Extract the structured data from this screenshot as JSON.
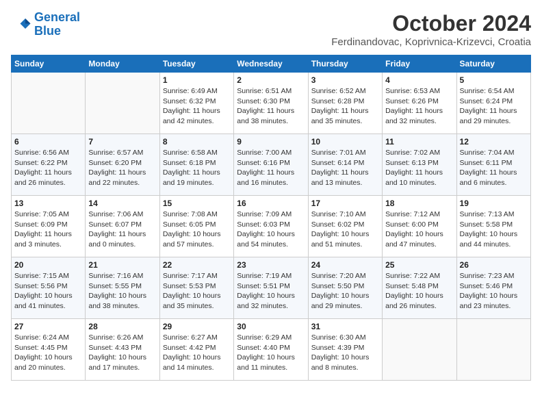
{
  "header": {
    "logo_line1": "General",
    "logo_line2": "Blue",
    "month": "October 2024",
    "location": "Ferdinandovac, Koprivnica-Krizevci, Croatia"
  },
  "weekdays": [
    "Sunday",
    "Monday",
    "Tuesday",
    "Wednesday",
    "Thursday",
    "Friday",
    "Saturday"
  ],
  "weeks": [
    [
      {
        "day": "",
        "info": ""
      },
      {
        "day": "",
        "info": ""
      },
      {
        "day": "1",
        "info": "Sunrise: 6:49 AM\nSunset: 6:32 PM\nDaylight: 11 hours and 42 minutes."
      },
      {
        "day": "2",
        "info": "Sunrise: 6:51 AM\nSunset: 6:30 PM\nDaylight: 11 hours and 38 minutes."
      },
      {
        "day": "3",
        "info": "Sunrise: 6:52 AM\nSunset: 6:28 PM\nDaylight: 11 hours and 35 minutes."
      },
      {
        "day": "4",
        "info": "Sunrise: 6:53 AM\nSunset: 6:26 PM\nDaylight: 11 hours and 32 minutes."
      },
      {
        "day": "5",
        "info": "Sunrise: 6:54 AM\nSunset: 6:24 PM\nDaylight: 11 hours and 29 minutes."
      }
    ],
    [
      {
        "day": "6",
        "info": "Sunrise: 6:56 AM\nSunset: 6:22 PM\nDaylight: 11 hours and 26 minutes."
      },
      {
        "day": "7",
        "info": "Sunrise: 6:57 AM\nSunset: 6:20 PM\nDaylight: 11 hours and 22 minutes."
      },
      {
        "day": "8",
        "info": "Sunrise: 6:58 AM\nSunset: 6:18 PM\nDaylight: 11 hours and 19 minutes."
      },
      {
        "day": "9",
        "info": "Sunrise: 7:00 AM\nSunset: 6:16 PM\nDaylight: 11 hours and 16 minutes."
      },
      {
        "day": "10",
        "info": "Sunrise: 7:01 AM\nSunset: 6:14 PM\nDaylight: 11 hours and 13 minutes."
      },
      {
        "day": "11",
        "info": "Sunrise: 7:02 AM\nSunset: 6:13 PM\nDaylight: 11 hours and 10 minutes."
      },
      {
        "day": "12",
        "info": "Sunrise: 7:04 AM\nSunset: 6:11 PM\nDaylight: 11 hours and 6 minutes."
      }
    ],
    [
      {
        "day": "13",
        "info": "Sunrise: 7:05 AM\nSunset: 6:09 PM\nDaylight: 11 hours and 3 minutes."
      },
      {
        "day": "14",
        "info": "Sunrise: 7:06 AM\nSunset: 6:07 PM\nDaylight: 11 hours and 0 minutes."
      },
      {
        "day": "15",
        "info": "Sunrise: 7:08 AM\nSunset: 6:05 PM\nDaylight: 10 hours and 57 minutes."
      },
      {
        "day": "16",
        "info": "Sunrise: 7:09 AM\nSunset: 6:03 PM\nDaylight: 10 hours and 54 minutes."
      },
      {
        "day": "17",
        "info": "Sunrise: 7:10 AM\nSunset: 6:02 PM\nDaylight: 10 hours and 51 minutes."
      },
      {
        "day": "18",
        "info": "Sunrise: 7:12 AM\nSunset: 6:00 PM\nDaylight: 10 hours and 47 minutes."
      },
      {
        "day": "19",
        "info": "Sunrise: 7:13 AM\nSunset: 5:58 PM\nDaylight: 10 hours and 44 minutes."
      }
    ],
    [
      {
        "day": "20",
        "info": "Sunrise: 7:15 AM\nSunset: 5:56 PM\nDaylight: 10 hours and 41 minutes."
      },
      {
        "day": "21",
        "info": "Sunrise: 7:16 AM\nSunset: 5:55 PM\nDaylight: 10 hours and 38 minutes."
      },
      {
        "day": "22",
        "info": "Sunrise: 7:17 AM\nSunset: 5:53 PM\nDaylight: 10 hours and 35 minutes."
      },
      {
        "day": "23",
        "info": "Sunrise: 7:19 AM\nSunset: 5:51 PM\nDaylight: 10 hours and 32 minutes."
      },
      {
        "day": "24",
        "info": "Sunrise: 7:20 AM\nSunset: 5:50 PM\nDaylight: 10 hours and 29 minutes."
      },
      {
        "day": "25",
        "info": "Sunrise: 7:22 AM\nSunset: 5:48 PM\nDaylight: 10 hours and 26 minutes."
      },
      {
        "day": "26",
        "info": "Sunrise: 7:23 AM\nSunset: 5:46 PM\nDaylight: 10 hours and 23 minutes."
      }
    ],
    [
      {
        "day": "27",
        "info": "Sunrise: 6:24 AM\nSunset: 4:45 PM\nDaylight: 10 hours and 20 minutes."
      },
      {
        "day": "28",
        "info": "Sunrise: 6:26 AM\nSunset: 4:43 PM\nDaylight: 10 hours and 17 minutes."
      },
      {
        "day": "29",
        "info": "Sunrise: 6:27 AM\nSunset: 4:42 PM\nDaylight: 10 hours and 14 minutes."
      },
      {
        "day": "30",
        "info": "Sunrise: 6:29 AM\nSunset: 4:40 PM\nDaylight: 10 hours and 11 minutes."
      },
      {
        "day": "31",
        "info": "Sunrise: 6:30 AM\nSunset: 4:39 PM\nDaylight: 10 hours and 8 minutes."
      },
      {
        "day": "",
        "info": ""
      },
      {
        "day": "",
        "info": ""
      }
    ]
  ]
}
